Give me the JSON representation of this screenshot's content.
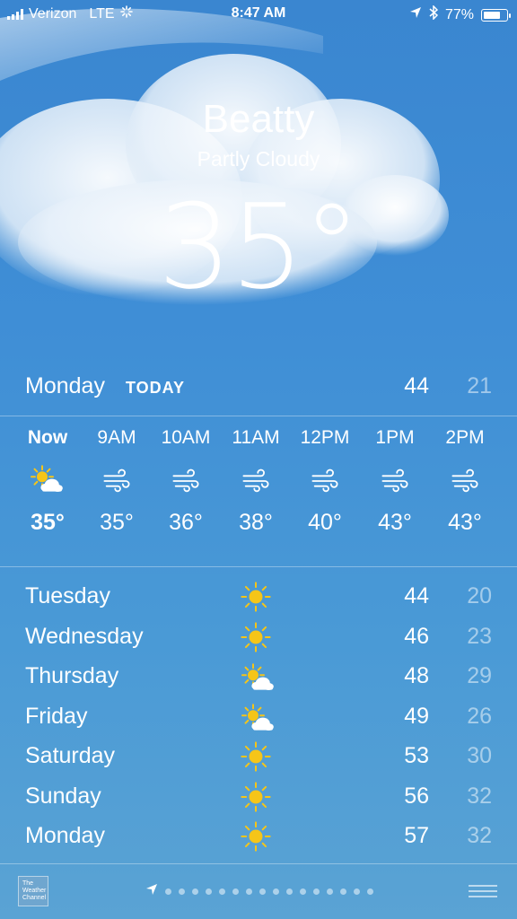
{
  "status_bar": {
    "carrier": "Verizon",
    "network": "LTE",
    "time": "8:47 AM",
    "battery": "77%"
  },
  "location": {
    "city": "Beatty",
    "condition": "Partly Cloudy",
    "temperature": "35°"
  },
  "today": {
    "day": "Monday",
    "tag": "TODAY",
    "high": "44",
    "low": "21"
  },
  "hourly": [
    {
      "time": "Now",
      "icon": "partly-cloudy-icon",
      "temp": "35°"
    },
    {
      "time": "9AM",
      "icon": "wind-icon",
      "temp": "35°"
    },
    {
      "time": "10AM",
      "icon": "wind-icon",
      "temp": "36°"
    },
    {
      "time": "11AM",
      "icon": "wind-icon",
      "temp": "38°"
    },
    {
      "time": "12PM",
      "icon": "wind-icon",
      "temp": "40°"
    },
    {
      "time": "1PM",
      "icon": "wind-icon",
      "temp": "43°"
    },
    {
      "time": "2PM",
      "icon": "wind-icon",
      "temp": "43°"
    }
  ],
  "daily": [
    {
      "day": "Tuesday",
      "icon": "sun-icon",
      "high": "44",
      "low": "20"
    },
    {
      "day": "Wednesday",
      "icon": "sun-icon",
      "high": "46",
      "low": "23"
    },
    {
      "day": "Thursday",
      "icon": "partly-cloudy-icon",
      "high": "48",
      "low": "29"
    },
    {
      "day": "Friday",
      "icon": "partly-cloudy-icon",
      "high": "49",
      "low": "26"
    },
    {
      "day": "Saturday",
      "icon": "sun-icon",
      "high": "53",
      "low": "30"
    },
    {
      "day": "Sunday",
      "icon": "sun-icon",
      "high": "56",
      "low": "32"
    },
    {
      "day": "Monday",
      "icon": "sun-icon",
      "high": "57",
      "low": "32"
    }
  ],
  "footer": {
    "logo_text": "The Weather Channel",
    "page_dots": 16
  },
  "colors": {
    "background": "#3f8ed6",
    "sun": "#f5c518"
  }
}
